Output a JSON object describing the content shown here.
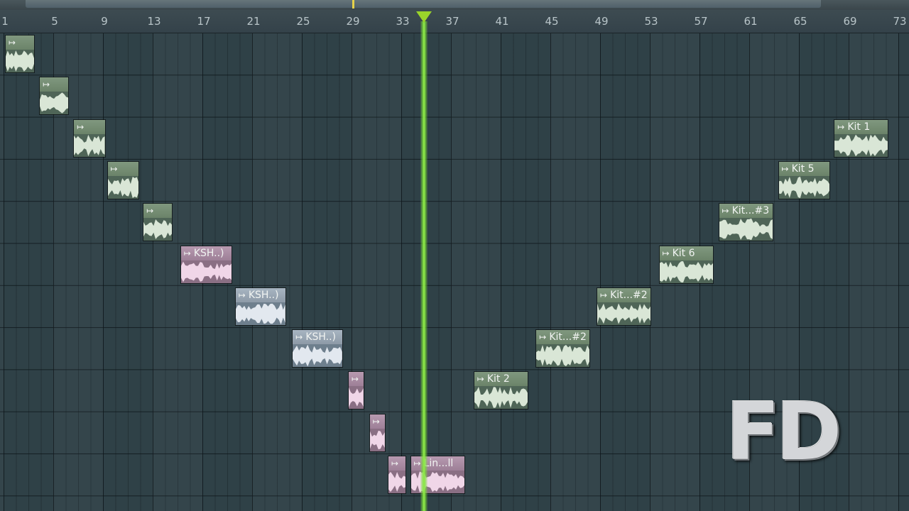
{
  "ruler": {
    "bar_numbers": [
      "1",
      "5",
      "9",
      "13",
      "17",
      "21",
      "25",
      "29",
      "33",
      "37",
      "41",
      "45",
      "49",
      "53",
      "57",
      "61",
      "65",
      "69",
      "73"
    ]
  },
  "playhead": {
    "bar": 34.7
  },
  "clips": [
    {
      "label": "",
      "color": "green",
      "bar": 1,
      "track": 1,
      "length_bars": 2.4
    },
    {
      "label": "",
      "color": "green",
      "bar": 3.75,
      "track": 2,
      "length_bars": 2.4
    },
    {
      "label": "",
      "color": "green",
      "bar": 6.5,
      "track": 3,
      "length_bars": 2.6
    },
    {
      "label": "",
      "color": "green",
      "bar": 9.2,
      "track": 4,
      "length_bars": 2.6
    },
    {
      "label": "",
      "color": "green",
      "bar": 12.1,
      "track": 5,
      "length_bars": 2.4
    },
    {
      "label": "KSH..)",
      "color": "pink",
      "bar": 15.1,
      "track": 6,
      "length_bars": 4.2
    },
    {
      "label": "KSH..)",
      "color": "blue",
      "bar": 19.5,
      "track": 7,
      "length_bars": 4.1
    },
    {
      "label": "KSH..)",
      "color": "blue",
      "bar": 24.1,
      "track": 8,
      "length_bars": 4.1
    },
    {
      "label": "",
      "color": "pink",
      "bar": 28.6,
      "track": 9,
      "length_bars": 1.3
    },
    {
      "label": "",
      "color": "pink",
      "bar": 30.3,
      "track": 10,
      "length_bars": 1.3
    },
    {
      "label": "",
      "color": "pink",
      "bar": 31.8,
      "track": 11,
      "length_bars": 1.5
    },
    {
      "label": "Lin...ll",
      "color": "pink",
      "bar": 33.6,
      "track": 11,
      "length_bars": 4.4
    },
    {
      "label": "Kit 2",
      "color": "green",
      "bar": 38.7,
      "track": 9,
      "length_bars": 4.4
    },
    {
      "label": "Kit...#2",
      "color": "green",
      "bar": 43.7,
      "track": 8,
      "length_bars": 4.4
    },
    {
      "label": "Kit...#2",
      "color": "green",
      "bar": 48.6,
      "track": 7,
      "length_bars": 4.4
    },
    {
      "label": "Kit 6",
      "color": "green",
      "bar": 53.6,
      "track": 6,
      "length_bars": 4.4
    },
    {
      "label": "Kit...#3",
      "color": "green",
      "bar": 58.4,
      "track": 5,
      "length_bars": 4.4
    },
    {
      "label": "Kit 5",
      "color": "green",
      "bar": 63.2,
      "track": 4,
      "length_bars": 4.2
    },
    {
      "label": "Kit 1",
      "color": "green",
      "bar": 67.7,
      "track": 3,
      "length_bars": 4.4
    }
  ],
  "logo": {
    "text": "FD"
  }
}
